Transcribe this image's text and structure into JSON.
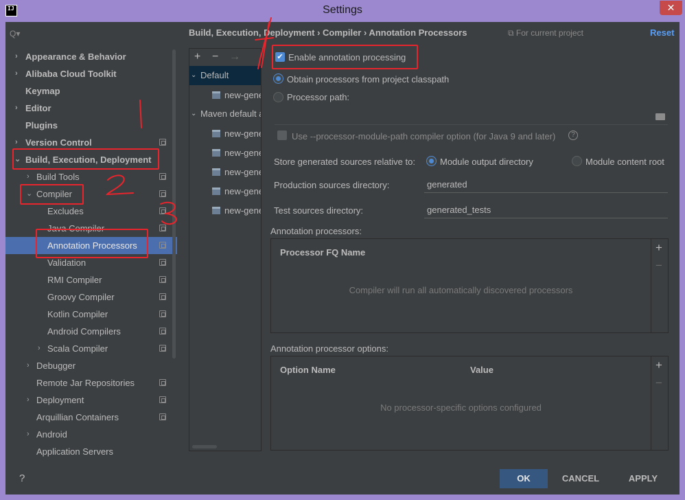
{
  "window": {
    "title": "Settings",
    "app_icon_text": "IJ",
    "close_glyph": "✕"
  },
  "search": {
    "glyph": "Q▾"
  },
  "tree": {
    "items": [
      {
        "label": "Appearance & Behavior"
      },
      {
        "label": "Alibaba Cloud Toolkit"
      },
      {
        "label": "Keymap"
      },
      {
        "label": "Editor"
      },
      {
        "label": "Plugins"
      },
      {
        "label": "Version Control"
      },
      {
        "label": "Build, Execution, Deployment"
      },
      {
        "label": "Build Tools"
      },
      {
        "label": "Compiler"
      },
      {
        "label": "Excludes"
      },
      {
        "label": "Java Compiler"
      },
      {
        "label": "Annotation Processors"
      },
      {
        "label": "Validation"
      },
      {
        "label": "RMI Compiler"
      },
      {
        "label": "Groovy Compiler"
      },
      {
        "label": "Kotlin Compiler"
      },
      {
        "label": "Android Compilers"
      },
      {
        "label": "Scala Compiler"
      },
      {
        "label": "Debugger"
      },
      {
        "label": "Remote Jar Repositories"
      },
      {
        "label": "Deployment"
      },
      {
        "label": "Arquillian Containers"
      },
      {
        "label": "Android"
      },
      {
        "label": "Application Servers"
      }
    ]
  },
  "breadcrumb": "Build, Execution, Deployment  ›  Compiler  ›  Annotation Processors",
  "for_current_project": "For current project",
  "reset_label": "Reset",
  "profiles": {
    "toolbar": {
      "add": "+",
      "remove": "−",
      "move": "→"
    },
    "items": [
      {
        "label": "Default"
      },
      {
        "label": "new-generator"
      },
      {
        "label": "Maven default annotation processors profile"
      },
      {
        "label": "new-generator"
      },
      {
        "label": "new-generator"
      },
      {
        "label": "new-generator"
      },
      {
        "label": "new-generator"
      },
      {
        "label": "new-generator"
      }
    ]
  },
  "options": {
    "enable_label": "Enable annotation processing",
    "obtain_label": "Obtain processors from project classpath",
    "processor_path_label": "Processor path:",
    "module_path_label": "Use --processor-module-path compiler option (for Java 9 and later)",
    "help_glyph": "?",
    "store_label": "Store generated sources relative to:",
    "module_output_label": "Module output directory",
    "module_content_label": "Module content root",
    "production_label": "Production sources directory:",
    "production_value": "generated",
    "test_label": "Test sources directory:",
    "test_value": "generated_tests"
  },
  "processors_table": {
    "section_label": "Annotation processors:",
    "column": "Processor FQ Name",
    "empty_text": "Compiler will run all automatically discovered processors",
    "add": "+",
    "remove": "−"
  },
  "options_table": {
    "section_label": "Annotation processor options:",
    "col_name": "Option Name",
    "col_value": "Value",
    "empty_text": "No processor-specific options configured",
    "add": "+",
    "remove": "−"
  },
  "buttons": {
    "help": "?",
    "ok": "OK",
    "cancel": "CANCEL",
    "apply": "APPLY"
  },
  "annotation_color": "#e8242c"
}
